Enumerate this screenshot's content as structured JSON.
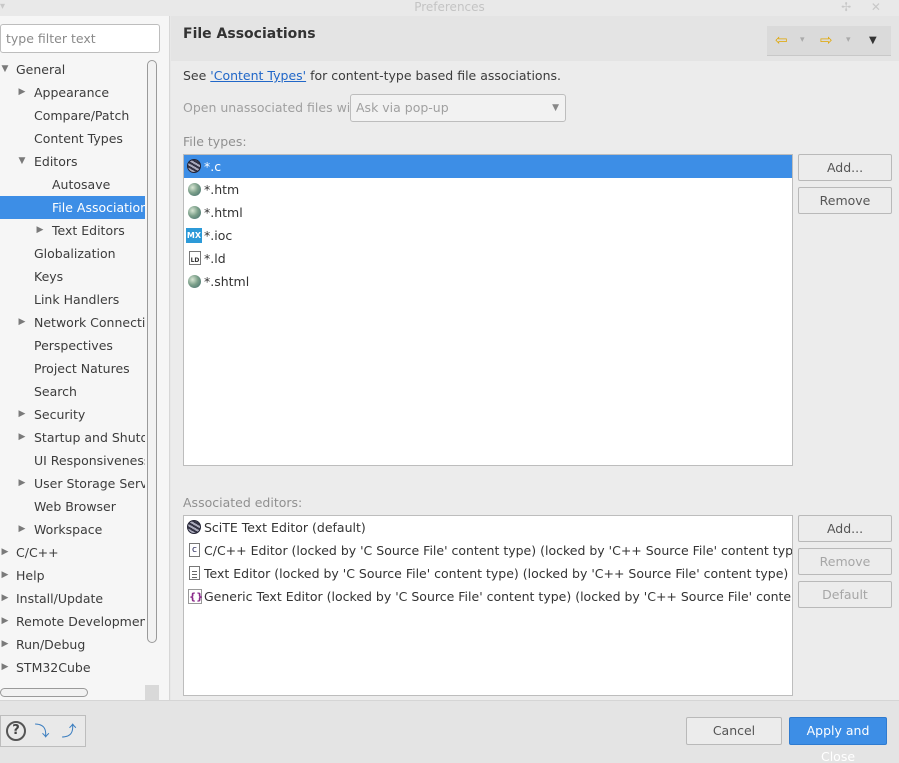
{
  "window": {
    "title": "Preferences",
    "controls": "✢ ✕",
    "left_glyph": "▾"
  },
  "filter": {
    "placeholder": "type filter text"
  },
  "tree": [
    {
      "label": "General",
      "depth": 0,
      "twisty": "open"
    },
    {
      "label": "Appearance",
      "depth": 1,
      "twisty": "closed"
    },
    {
      "label": "Compare/Patch",
      "depth": 1,
      "twisty": "none"
    },
    {
      "label": "Content Types",
      "depth": 1,
      "twisty": "none"
    },
    {
      "label": "Editors",
      "depth": 1,
      "twisty": "open"
    },
    {
      "label": "Autosave",
      "depth": 2,
      "twisty": "none"
    },
    {
      "label": "File Associations",
      "depth": 2,
      "twisty": "none",
      "selected": true
    },
    {
      "label": "Text Editors",
      "depth": 2,
      "twisty": "closed"
    },
    {
      "label": "Globalization",
      "depth": 1,
      "twisty": "none"
    },
    {
      "label": "Keys",
      "depth": 1,
      "twisty": "none"
    },
    {
      "label": "Link Handlers",
      "depth": 1,
      "twisty": "none"
    },
    {
      "label": "Network Connections",
      "depth": 1,
      "twisty": "closed"
    },
    {
      "label": "Perspectives",
      "depth": 1,
      "twisty": "none"
    },
    {
      "label": "Project Natures",
      "depth": 1,
      "twisty": "none"
    },
    {
      "label": "Search",
      "depth": 1,
      "twisty": "none"
    },
    {
      "label": "Security",
      "depth": 1,
      "twisty": "closed"
    },
    {
      "label": "Startup and Shutdown",
      "depth": 1,
      "twisty": "closed"
    },
    {
      "label": "UI Responsiveness Monitoring",
      "depth": 1,
      "twisty": "none"
    },
    {
      "label": "User Storage Service",
      "depth": 1,
      "twisty": "closed"
    },
    {
      "label": "Web Browser",
      "depth": 1,
      "twisty": "none"
    },
    {
      "label": "Workspace",
      "depth": 1,
      "twisty": "closed"
    },
    {
      "label": "C/C++",
      "depth": 0,
      "twisty": "closed"
    },
    {
      "label": "Help",
      "depth": 0,
      "twisty": "closed"
    },
    {
      "label": "Install/Update",
      "depth": 0,
      "twisty": "closed"
    },
    {
      "label": "Remote Development",
      "depth": 0,
      "twisty": "closed"
    },
    {
      "label": "Run/Debug",
      "depth": 0,
      "twisty": "closed"
    },
    {
      "label": "STM32Cube",
      "depth": 0,
      "twisty": "closed"
    }
  ],
  "page": {
    "title": "File Associations",
    "nav": {
      "back": "⇦",
      "forward": "⇨",
      "dropdown": "▾",
      "menu": "▼"
    },
    "see_prefix": "See ",
    "see_link": "'Content Types'",
    "see_suffix": " for content-type based file associations.",
    "open_label": "Open unassociated files with:",
    "open_value": "Ask via pop-up",
    "file_types_label": "File types:",
    "file_types": [
      {
        "label": "*.c",
        "icon": "scite-icon",
        "selected": true
      },
      {
        "label": "*.htm",
        "icon": "globe-icon"
      },
      {
        "label": "*.html",
        "icon": "globe-icon"
      },
      {
        "label": "*.ioc",
        "icon": "mx-icon",
        "badge": "MX"
      },
      {
        "label": "*.ld",
        "icon": "ld-file-icon",
        "badge": "LD"
      },
      {
        "label": "*.shtml",
        "icon": "globe-icon"
      }
    ],
    "ft_add": "Add...",
    "ft_remove": "Remove",
    "assoc_label": "Associated editors:",
    "editors": [
      {
        "label": "SciTE Text Editor (default)",
        "icon": "scite-icon"
      },
      {
        "label": "C/C++ Editor (locked by 'C Source File' content type) (locked by 'C++ Source File' content type)",
        "icon": "c-file-icon",
        "badge": "c"
      },
      {
        "label": "Text Editor (locked by 'C Source File' content type) (locked by 'C++ Source File' content type)",
        "icon": "text-file-icon"
      },
      {
        "label": "Generic Text Editor (locked by 'C Source File' content type) (locked by 'C++ Source File' content type)",
        "icon": "generic-editor-icon",
        "badge": "{}"
      }
    ],
    "ed_add": "Add...",
    "ed_remove": "Remove",
    "ed_default": "Default"
  },
  "bottom": {
    "help_glyph": "?",
    "import_glyph": "⤵",
    "export_glyph": "⤴",
    "cancel": "Cancel",
    "apply": "Apply and Close"
  },
  "colors": {
    "accent": "#3d8ee6",
    "link": "#2167c8"
  }
}
